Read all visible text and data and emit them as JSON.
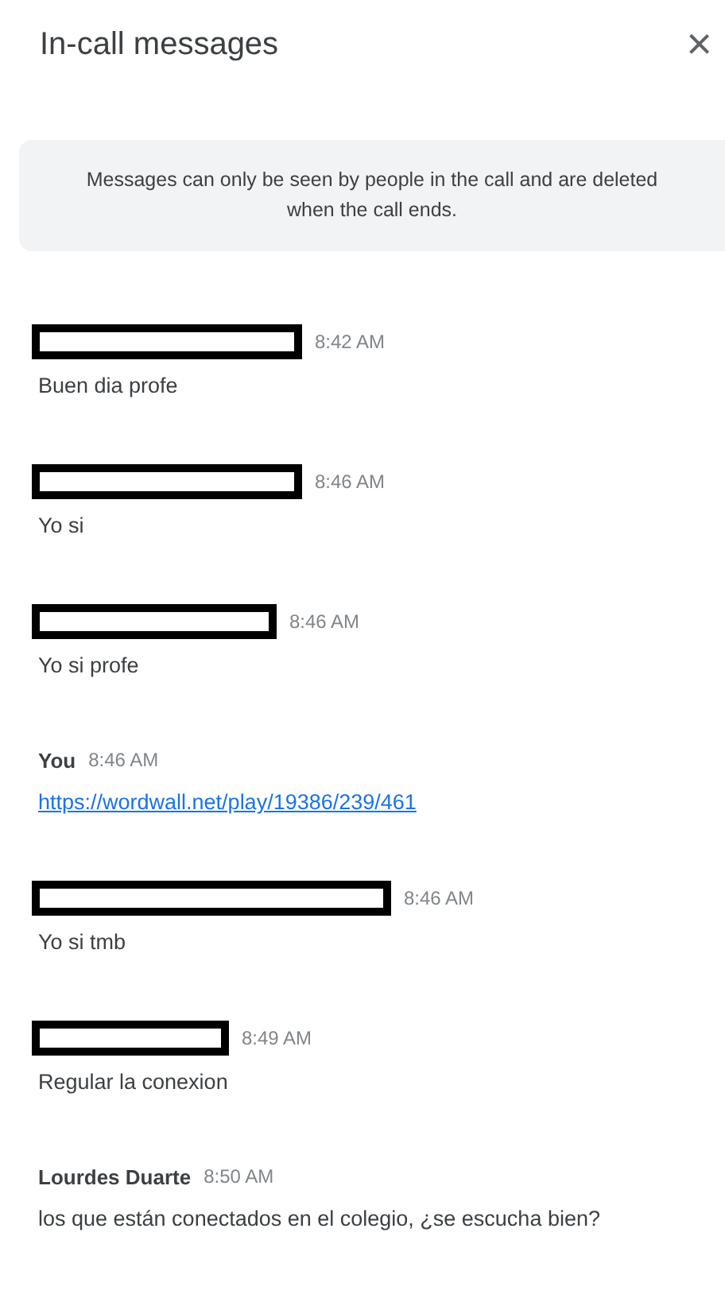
{
  "header": {
    "title": "In-call messages",
    "close": "×"
  },
  "notice": "Messages can only be seen by people in the call and are deleted when the call ends.",
  "messages": [
    {
      "sender": {
        "kind": "redacted"
      },
      "time": "8:42 AM",
      "body": {
        "kind": "text",
        "text": "Buen dia profe"
      }
    },
    {
      "sender": {
        "kind": "redacted"
      },
      "time": "8:46 AM",
      "body": {
        "kind": "text",
        "text": "Yo si"
      }
    },
    {
      "sender": {
        "kind": "redacted"
      },
      "time": "8:46 AM",
      "body": {
        "kind": "text",
        "text": "Yo si profe"
      }
    },
    {
      "sender": {
        "kind": "named",
        "name": "You"
      },
      "time": "8:46 AM",
      "body": {
        "kind": "link",
        "text": "https://wordwall.net/play/19386/239/461"
      }
    },
    {
      "sender": {
        "kind": "redacted"
      },
      "time": "8:46 AM",
      "body": {
        "kind": "text",
        "text": "Yo si tmb"
      }
    },
    {
      "sender": {
        "kind": "redacted"
      },
      "time": "8:49 AM",
      "body": {
        "kind": "text",
        "text": "Regular la conexion"
      }
    },
    {
      "sender": {
        "kind": "named",
        "name": "Lourdes Duarte"
      },
      "time": "8:50 AM",
      "body": {
        "kind": "text",
        "text": "los que están conectados en el colegio, ¿se escucha bien?"
      }
    }
  ]
}
